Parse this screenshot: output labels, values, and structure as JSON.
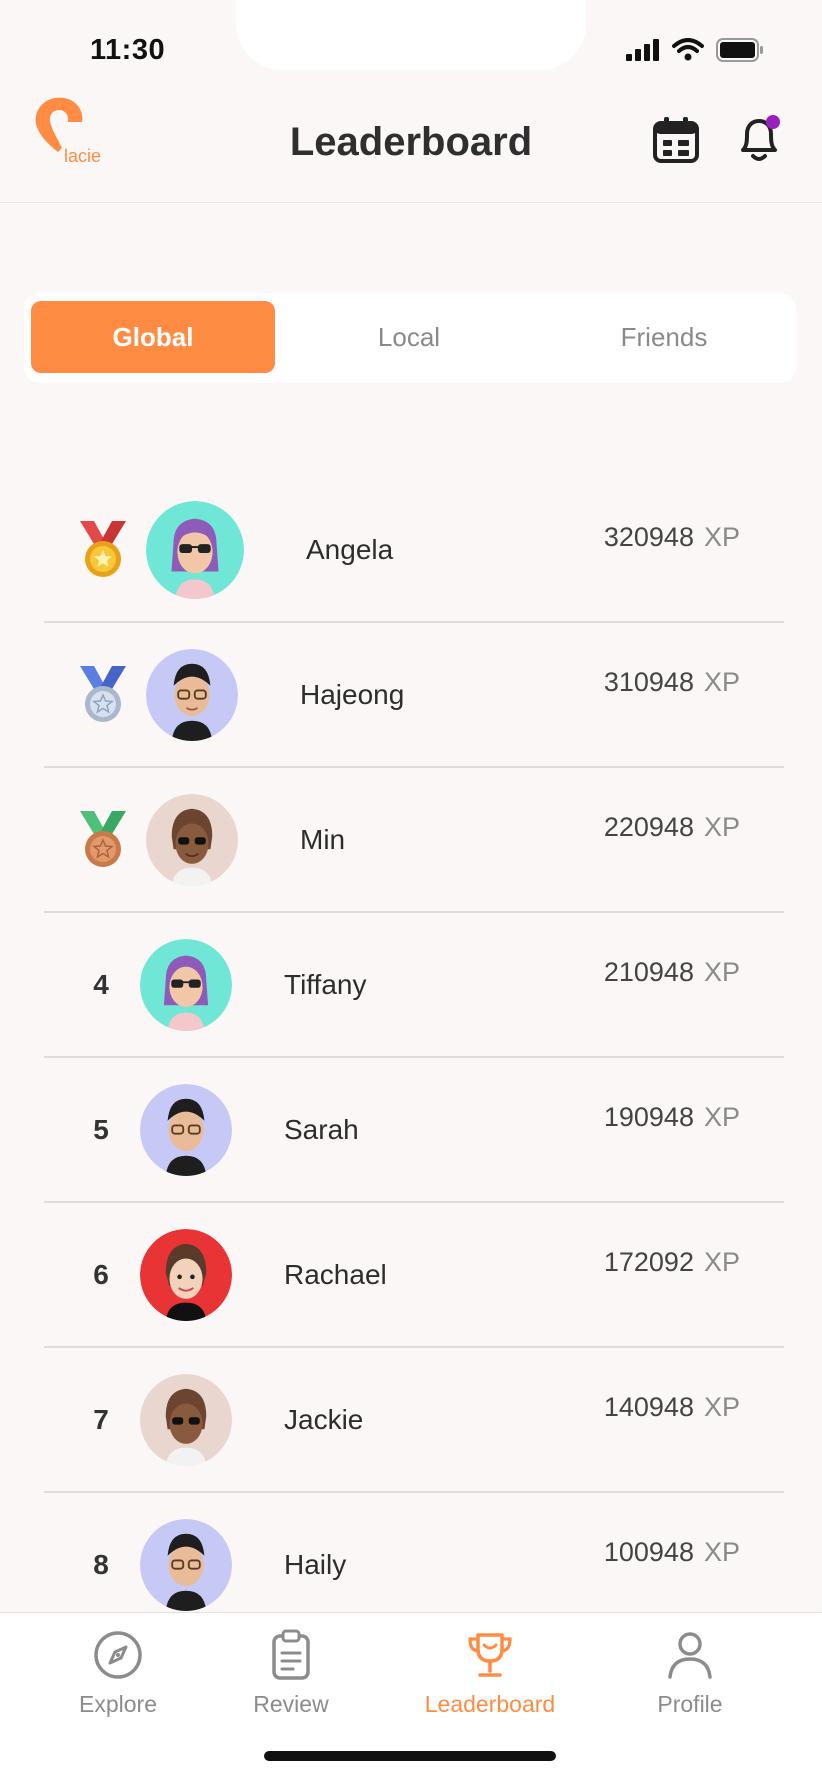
{
  "status_bar": {
    "time": "11:30"
  },
  "header": {
    "title": "Leaderboard",
    "logo_text": "lacie"
  },
  "colors": {
    "accent": "#ff8c42",
    "notification_dot": "#9b1fbf"
  },
  "tabs": [
    {
      "label": "Global",
      "active": true
    },
    {
      "label": "Local",
      "active": false
    },
    {
      "label": "Friends",
      "active": false
    }
  ],
  "leaderboard": [
    {
      "rank": "1",
      "medal": "gold-medal-icon",
      "name": "Angela",
      "xp": "320948",
      "unit": "XP",
      "avatar_bg": "#6fe6d6"
    },
    {
      "rank": "2",
      "medal": "silver-medal-icon",
      "name": "Hajeong",
      "xp": "310948",
      "unit": "XP",
      "avatar_bg": "#c6c9f5"
    },
    {
      "rank": "3",
      "medal": "bronze-medal-icon",
      "name": "Min",
      "xp": "220948",
      "unit": "XP",
      "avatar_bg": "#e8d6cf"
    },
    {
      "rank": "4",
      "medal": "",
      "name": "Tiffany",
      "xp": "210948",
      "unit": "XP",
      "avatar_bg": "#6fe6d6"
    },
    {
      "rank": "5",
      "medal": "",
      "name": "Sarah",
      "xp": "190948",
      "unit": "XP",
      "avatar_bg": "#c6c9f5"
    },
    {
      "rank": "6",
      "medal": "",
      "name": "Rachael",
      "xp": "172092",
      "unit": "XP",
      "avatar_bg": "#e83434"
    },
    {
      "rank": "7",
      "medal": "",
      "name": "Jackie",
      "xp": "140948",
      "unit": "XP",
      "avatar_bg": "#e8d6cf"
    },
    {
      "rank": "8",
      "medal": "",
      "name": "Haily",
      "xp": "100948",
      "unit": "XP",
      "avatar_bg": "#c6c9f5"
    }
  ],
  "bottom_nav": [
    {
      "label": "Explore",
      "icon": "compass-icon",
      "active": false
    },
    {
      "label": "Review",
      "icon": "clipboard-icon",
      "active": false
    },
    {
      "label": "Leaderboard",
      "icon": "trophy-icon",
      "active": true
    },
    {
      "label": "Profile",
      "icon": "person-icon",
      "active": false
    }
  ]
}
